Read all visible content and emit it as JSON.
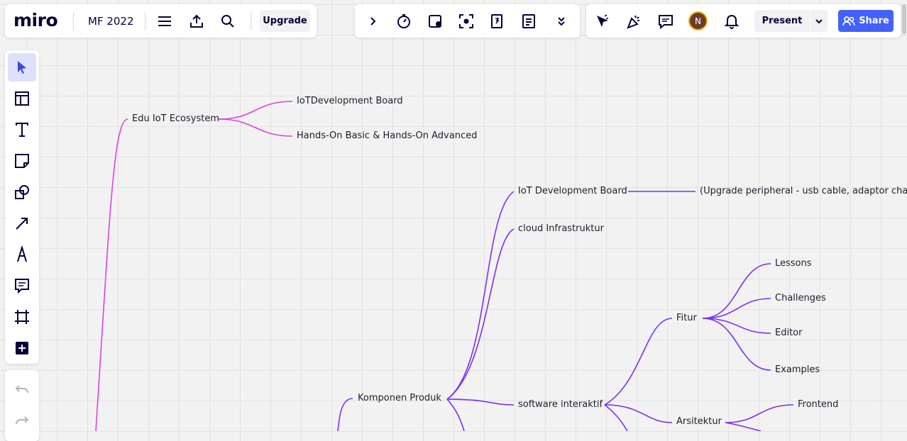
{
  "app": {
    "logo": "miro",
    "board_title": "MF 2022",
    "upgrade_label": "Upgrade"
  },
  "toolbar_right": {
    "avatar_initial": "N",
    "present_label": "Present",
    "share_label": "Share"
  },
  "left_tools": [
    "select",
    "templates",
    "text",
    "sticky-note",
    "shapes",
    "connection-line",
    "pen",
    "comment",
    "frame",
    "add-more"
  ],
  "colors": {
    "accent": "#4262ff",
    "branch_pink": "#e040e0",
    "branch_purple": "#7b2ff7"
  },
  "mindmap": {
    "nodes": {
      "edu_iot": "Edu IoT Ecosystem",
      "iot_dev_board_1": "IoTDevelopment Board",
      "hands_on": "Hands-On Basic & Hands-On Advanced",
      "iot_dev_board_2": "IoT Development Board",
      "upgrade_peripheral": "(Upgrade peripheral - usb cable, adaptor charger",
      "cloud": "cloud Infrastruktur",
      "komponen": "Komponen Produk",
      "software": "software interaktif",
      "fitur": "Fitur",
      "lessons": "Lessons",
      "challenges": "Challenges",
      "editor": "Editor",
      "examples": "Examples",
      "arsitektur": "Arsitektur",
      "frontend": "Frontend"
    }
  }
}
